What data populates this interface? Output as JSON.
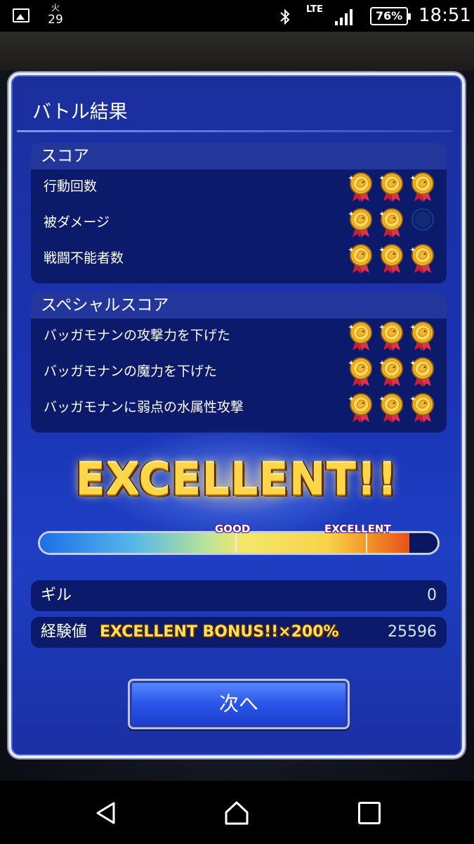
{
  "status_bar": {
    "day": "火",
    "date": "29",
    "network": "LTE",
    "battery": "76%",
    "time": "18:51"
  },
  "dialog": {
    "title": "バトル結果"
  },
  "score": {
    "header": "スコア",
    "rows": [
      {
        "label": "行動回数",
        "medals_earned": 3
      },
      {
        "label": "被ダメージ",
        "medals_earned": 2
      },
      {
        "label": "戦闘不能者数",
        "medals_earned": 3
      }
    ]
  },
  "special_score": {
    "header": "スペシャルスコア",
    "rows": [
      {
        "label": "バッガモナンの攻撃力を下げた",
        "medals_earned": 3
      },
      {
        "label": "バッガモナンの魔力を下げた",
        "medals_earned": 3
      },
      {
        "label": "バッガモナンに弱点の水属性攻撃",
        "medals_earned": 3
      }
    ]
  },
  "rating": {
    "banner": "EXCELLENT!!",
    "gauge_good_label": "GOOD",
    "gauge_excellent_label": "EXCELLENT",
    "gauge_fill": 0.93
  },
  "rewards": {
    "gil_label": "ギル",
    "gil_value": "0",
    "exp_label": "経験値",
    "exp_bonus": "EXCELLENT BONUS!!×200%",
    "exp_value": "25596"
  },
  "buttons": {
    "next": "次へ"
  },
  "colors": {
    "dialog_blue": "#1a33b3",
    "panel_navy": "#0b1a6b",
    "gold": "#ffd64a"
  }
}
